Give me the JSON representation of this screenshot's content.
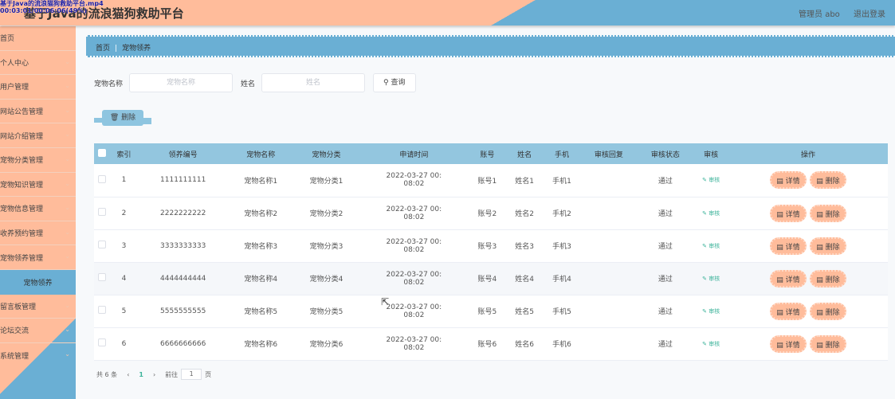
{
  "header": {
    "title": "基于Java的流浪猫狗救助平台",
    "user": "管理员 abo",
    "logout": "退出登录"
  },
  "video_overlay": {
    "filename": "基于Java的流浪猫狗救助平台.mp4",
    "time": "00:03:01/00:06:06(49%)"
  },
  "sidebar": {
    "items": [
      {
        "label": "首页",
        "chevron": false
      },
      {
        "label": "个人中心",
        "chevron": true
      },
      {
        "label": "用户管理",
        "chevron": true
      },
      {
        "label": "网站公告管理",
        "chevron": true
      },
      {
        "label": "网站介绍管理",
        "chevron": true
      },
      {
        "label": "宠物分类管理",
        "chevron": true
      },
      {
        "label": "宠物知识管理",
        "chevron": true
      },
      {
        "label": "宠物信息管理",
        "chevron": true
      },
      {
        "label": "收养预约管理",
        "chevron": true
      },
      {
        "label": "宠物领养管理",
        "chevron": true
      },
      {
        "label": "宠物领养",
        "active": true
      },
      {
        "label": "留言板管理",
        "chevron": true
      },
      {
        "label": "论坛交流",
        "chevron": true
      },
      {
        "label": "系统管理",
        "chevron": true
      }
    ]
  },
  "breadcrumb": {
    "home": "首页",
    "current": "宠物领养"
  },
  "search": {
    "pet_name_label": "宠物名称",
    "pet_name_placeholder": "宠物名称",
    "name_label": "姓名",
    "name_placeholder": "姓名",
    "query_label": "查询"
  },
  "toolbar": {
    "delete_label": "删除"
  },
  "table": {
    "headers": [
      "索引",
      "领养编号",
      "宠物名称",
      "宠物分类",
      "申请时间",
      "账号",
      "姓名",
      "手机",
      "审核回复",
      "审核状态",
      "审核",
      "操作"
    ],
    "rows": [
      {
        "index": "1",
        "no": "1111111111",
        "pet": "宠物名称1",
        "cat": "宠物分类1",
        "time1": "2022-03-27 00:",
        "time2": "08:02",
        "account": "账号1",
        "name": "姓名1",
        "phone": "手机1",
        "reply": "",
        "status": "通过"
      },
      {
        "index": "2",
        "no": "2222222222",
        "pet": "宠物名称2",
        "cat": "宠物分类2",
        "time1": "2022-03-27 00:",
        "time2": "08:02",
        "account": "账号2",
        "name": "姓名2",
        "phone": "手机2",
        "reply": "",
        "status": "通过"
      },
      {
        "index": "3",
        "no": "3333333333",
        "pet": "宠物名称3",
        "cat": "宠物分类3",
        "time1": "2022-03-27 00:",
        "time2": "08:02",
        "account": "账号3",
        "name": "姓名3",
        "phone": "手机3",
        "reply": "",
        "status": "通过"
      },
      {
        "index": "4",
        "no": "4444444444",
        "pet": "宠物名称4",
        "cat": "宠物分类4",
        "time1": "2022-03-27 00:",
        "time2": "08:02",
        "account": "账号4",
        "name": "姓名4",
        "phone": "手机4",
        "reply": "",
        "status": "通过"
      },
      {
        "index": "5",
        "no": "5555555555",
        "pet": "宠物名称5",
        "cat": "宠物分类5",
        "time1": "2022-03-27 00:",
        "time2": "08:02",
        "account": "账号5",
        "name": "姓名5",
        "phone": "手机5",
        "reply": "",
        "status": "通过"
      },
      {
        "index": "6",
        "no": "6666666666",
        "pet": "宠物名称6",
        "cat": "宠物分类6",
        "time1": "2022-03-27 00:",
        "time2": "08:02",
        "account": "账号6",
        "name": "姓名6",
        "phone": "手机6",
        "reply": "",
        "status": "通过"
      }
    ],
    "audit_label": "审核",
    "detail_label": "详情",
    "delete_label": "删除"
  },
  "pagination": {
    "total": "共 6 条",
    "current": "1",
    "goto": "前往",
    "page_value": "1",
    "page_suffix": "页"
  },
  "colors": {
    "salmon": "#ffbc9b",
    "blue": "#6aafd4",
    "green": "#3cb39a"
  }
}
